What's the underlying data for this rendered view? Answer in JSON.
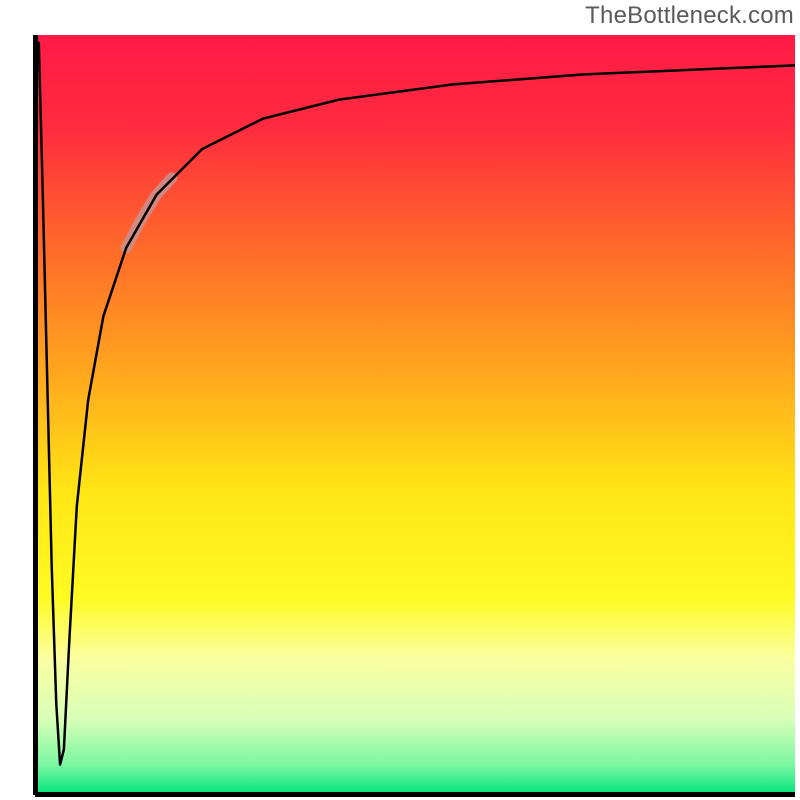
{
  "watermark": "TheBottleneck.com",
  "chart_data": {
    "type": "line",
    "title": "",
    "xlabel": "",
    "ylabel": "",
    "xlim": [
      0,
      100
    ],
    "ylim": [
      0,
      100
    ],
    "grid": false,
    "legend": false,
    "background_gradient": {
      "stops": [
        {
          "offset": 0.0,
          "color": "#ff1a46"
        },
        {
          "offset": 0.12,
          "color": "#ff2b3f"
        },
        {
          "offset": 0.28,
          "color": "#ff6a2a"
        },
        {
          "offset": 0.44,
          "color": "#ffa51e"
        },
        {
          "offset": 0.6,
          "color": "#ffe615"
        },
        {
          "offset": 0.74,
          "color": "#fffb22"
        },
        {
          "offset": 0.82,
          "color": "#fbffa0"
        },
        {
          "offset": 0.9,
          "color": "#d8ffb8"
        },
        {
          "offset": 0.96,
          "color": "#7cf7a2"
        },
        {
          "offset": 1.0,
          "color": "#00e47a"
        }
      ]
    },
    "series": [
      {
        "name": "bottleneck-curve",
        "color": "#000000",
        "stroke_width": 2.5,
        "points": [
          {
            "x": 0.5,
            "y": 99.0
          },
          {
            "x": 1.0,
            "y": 80.0
          },
          {
            "x": 1.6,
            "y": 55.0
          },
          {
            "x": 2.2,
            "y": 30.0
          },
          {
            "x": 2.8,
            "y": 12.0
          },
          {
            "x": 3.3,
            "y": 4.0
          },
          {
            "x": 3.8,
            "y": 6.0
          },
          {
            "x": 4.5,
            "y": 20.0
          },
          {
            "x": 5.5,
            "y": 38.0
          },
          {
            "x": 7.0,
            "y": 52.0
          },
          {
            "x": 9.0,
            "y": 63.0
          },
          {
            "x": 12.0,
            "y": 72.0
          },
          {
            "x": 16.0,
            "y": 79.0
          },
          {
            "x": 22.0,
            "y": 85.0
          },
          {
            "x": 30.0,
            "y": 89.0
          },
          {
            "x": 40.0,
            "y": 91.5
          },
          {
            "x": 55.0,
            "y": 93.5
          },
          {
            "x": 72.0,
            "y": 94.8
          },
          {
            "x": 88.0,
            "y": 95.5
          },
          {
            "x": 100.0,
            "y": 96.0
          }
        ]
      },
      {
        "name": "highlight-segment",
        "color": "#c9908e",
        "stroke_width": 11,
        "opacity": 0.85,
        "points": [
          {
            "x": 12.0,
            "y": 72.0
          },
          {
            "x": 14.0,
            "y": 75.8
          },
          {
            "x": 16.0,
            "y": 79.0
          },
          {
            "x": 18.0,
            "y": 81.2
          }
        ]
      }
    ]
  }
}
